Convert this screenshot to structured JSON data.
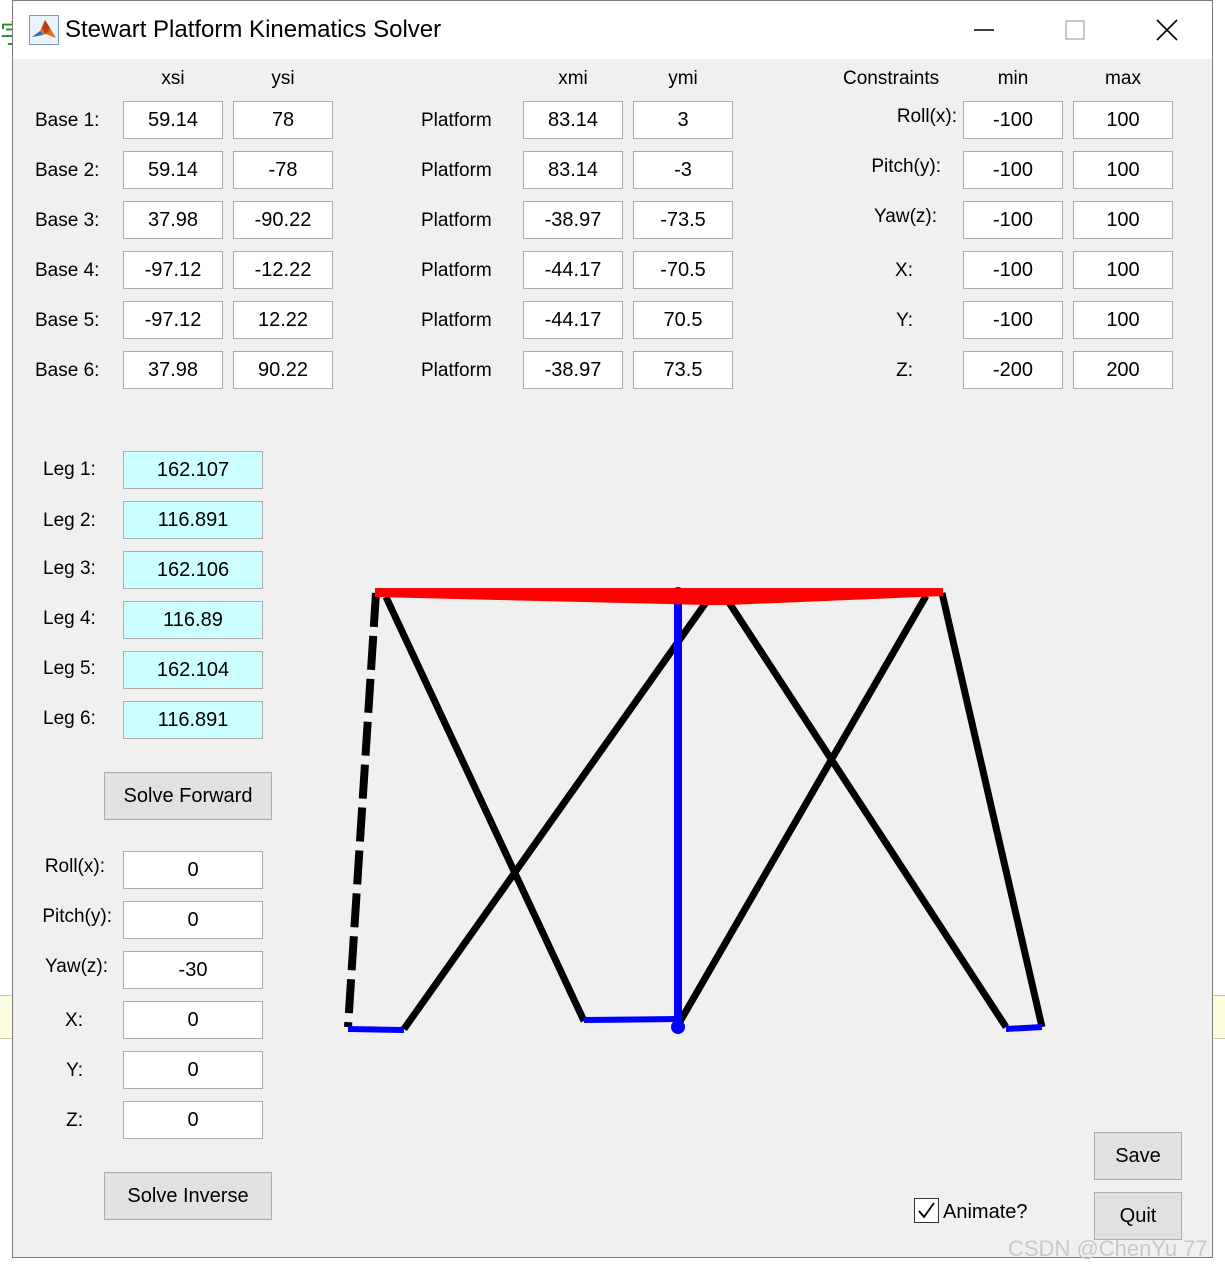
{
  "window": {
    "title": "Stewart Platform Kinematics Solver",
    "minimize_glyph": "—",
    "maximize_glyph": "☐",
    "close_glyph": "✕"
  },
  "base": {
    "col_xsi": "xsi",
    "col_ysi": "ysi",
    "rows": [
      {
        "label": "Base 1:",
        "xsi": "59.14",
        "ysi": "78"
      },
      {
        "label": "Base 2:",
        "xsi": "59.14",
        "ysi": "-78"
      },
      {
        "label": "Base 3:",
        "xsi": "37.98",
        "ysi": "-90.22"
      },
      {
        "label": "Base 4:",
        "xsi": "-97.12",
        "ysi": "-12.22"
      },
      {
        "label": "Base 5:",
        "xsi": "-97.12",
        "ysi": "12.22"
      },
      {
        "label": "Base 6:",
        "xsi": "37.98",
        "ysi": "90.22"
      }
    ]
  },
  "platform": {
    "col_xmi": "xmi",
    "col_ymi": "ymi",
    "rows": [
      {
        "label": "Platform",
        "xmi": "83.14",
        "ymi": "3"
      },
      {
        "label": "Platform",
        "xmi": "83.14",
        "ymi": "-3"
      },
      {
        "label": "Platform",
        "xmi": "-38.97",
        "ymi": "-73.5"
      },
      {
        "label": "Platform",
        "xmi": "-44.17",
        "ymi": "-70.5"
      },
      {
        "label": "Platform",
        "xmi": "-44.17",
        "ymi": "70.5"
      },
      {
        "label": "Platform",
        "xmi": "-38.97",
        "ymi": "73.5"
      }
    ]
  },
  "constraints": {
    "header": "Constraints",
    "col_min": "min",
    "col_max": "max",
    "rows": [
      {
        "label": "Roll(x):",
        "min": "-100",
        "max": "100"
      },
      {
        "label": "Pitch(y):",
        "min": "-100",
        "max": "100"
      },
      {
        "label": "Yaw(z):",
        "min": "-100",
        "max": "100"
      },
      {
        "label": "X:",
        "min": "-100",
        "max": "100"
      },
      {
        "label": "Y:",
        "min": "-100",
        "max": "100"
      },
      {
        "label": "Z:",
        "min": "-200",
        "max": "200"
      }
    ]
  },
  "legs": [
    {
      "label": "Leg 1:",
      "value": "162.107"
    },
    {
      "label": "Leg 2:",
      "value": "116.891"
    },
    {
      "label": "Leg 3:",
      "value": "162.106"
    },
    {
      "label": "Leg 4:",
      "value": "116.89"
    },
    {
      "label": "Leg 5:",
      "value": "162.104"
    },
    {
      "label": "Leg 6:",
      "value": "116.891"
    }
  ],
  "solve_forward_label": "Solve Forward",
  "pose": [
    {
      "label": "Roll(x):",
      "value": "0"
    },
    {
      "label": "Pitch(y):",
      "value": "0"
    },
    {
      "label": "Yaw(z):",
      "value": "-30"
    },
    {
      "label": "X:",
      "value": "0"
    },
    {
      "label": "Y:",
      "value": "0"
    },
    {
      "label": "Z:",
      "value": "0"
    }
  ],
  "solve_inverse_label": "Solve Inverse",
  "animate": {
    "label": "Animate?",
    "checked": true
  },
  "save_label": "Save",
  "quit_label": "Quit",
  "watermark": "CSDN @ChenYu 77",
  "colors": {
    "platform": "#ff0000",
    "base": "#0000ff",
    "legs": "#000000",
    "leg_value_bg": "#ccffff"
  }
}
